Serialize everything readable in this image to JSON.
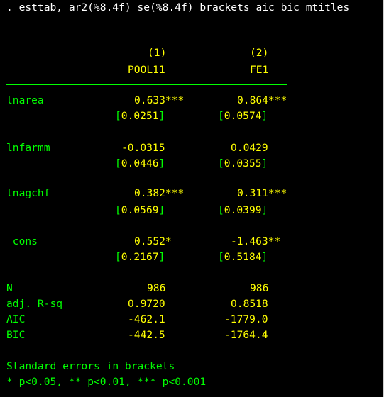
{
  "command": ". esttab, ar2(%8.4f) se(%8.4f) brackets aic bic mtitles",
  "header": {
    "col_numbers": [
      "(1)",
      "(2)"
    ],
    "col_titles": [
      "POOL11",
      "FE1"
    ]
  },
  "rows": [
    {
      "label": "lnarea",
      "coef": [
        "0.633***",
        "0.864***"
      ],
      "se": [
        "[0.0251]",
        "[0.0574]"
      ]
    },
    {
      "label": "lnfarmm",
      "coef": [
        "-0.0315",
        "0.0429"
      ],
      "se": [
        "[0.0446]",
        "[0.0355]"
      ]
    },
    {
      "label": "lnagchf",
      "coef": [
        "0.382***",
        "0.311***"
      ],
      "se": [
        "[0.0569]",
        "[0.0399]"
      ]
    },
    {
      "label": "_cons",
      "coef": [
        "0.552*",
        "-1.463**"
      ],
      "se": [
        "[0.2167]",
        "[0.5184]"
      ]
    }
  ],
  "stats": [
    {
      "label": "N",
      "values": [
        "986",
        "986"
      ]
    },
    {
      "label": "adj. R-sq",
      "values": [
        "0.9720",
        "0.8518"
      ]
    },
    {
      "label": "AIC",
      "values": [
        "-462.1",
        "-1779.0"
      ]
    },
    {
      "label": "BIC",
      "values": [
        "-442.5",
        "-1764.4"
      ]
    }
  ],
  "footer": {
    "note1": "Standard errors in brackets",
    "note2": "* p<0.05, ** p<0.01, *** p<0.001"
  },
  "colors": {
    "background": "#000000",
    "command_text": "#ffffff",
    "label_text": "#00ff00",
    "value_text": "#ffff00"
  }
}
